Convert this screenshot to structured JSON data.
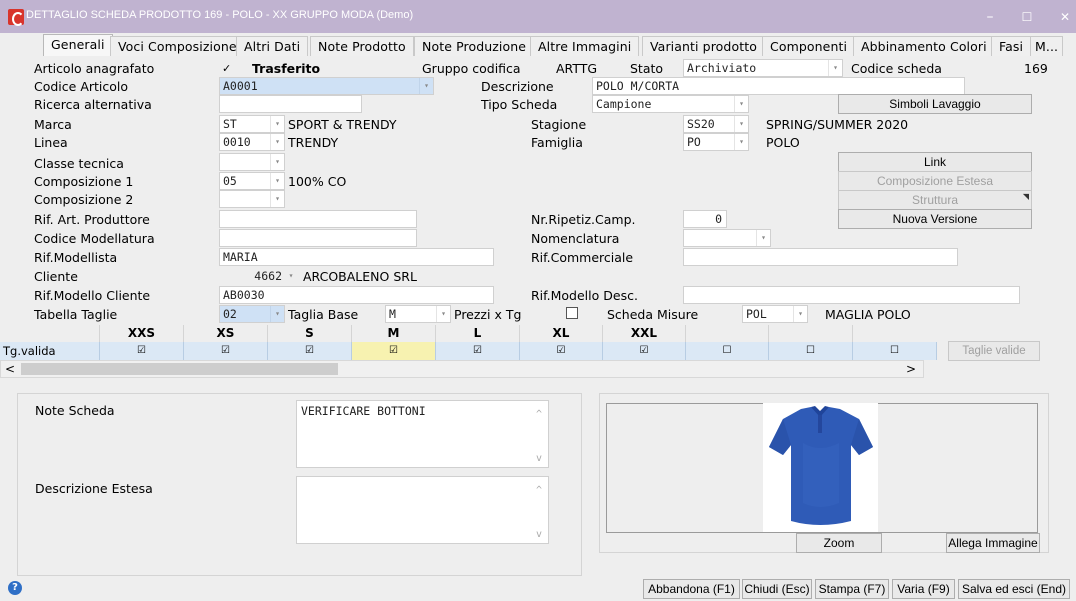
{
  "window": {
    "title": "DETTAGLIO SCHEDA PRODOTTO 169 - POLO - XX  GRUPPO MODA  (Demo)",
    "minimize": "–",
    "maximize": "☐",
    "close": "✕"
  },
  "tabs": [
    {
      "label": "Generali"
    },
    {
      "label": "Voci Composizione"
    },
    {
      "label": "Altri Dati"
    },
    {
      "label": "Note Prodotto"
    },
    {
      "label": "Note Produzione"
    },
    {
      "label": "Altre Immagini"
    },
    {
      "label": "Varianti prodotto"
    },
    {
      "label": "Componenti"
    },
    {
      "label": "Abbinamento Colori"
    },
    {
      "label": "Fasi"
    },
    {
      "label": "M..."
    }
  ],
  "form": {
    "articolo_anagrafato_label": "Articolo anagrafato",
    "articolo_anagrafato_check": "✓",
    "trasferito": "Trasferito",
    "gruppo_codifica_label": "Gruppo codifica",
    "gruppo_codifica_value": "ARTTG",
    "stato_label": "Stato",
    "stato_value": "Archiviato",
    "codice_scheda_label": "Codice scheda",
    "codice_scheda_value": "169",
    "codice_articolo_label": "Codice Articolo",
    "codice_articolo_value": "A0001",
    "descrizione_label": "Descrizione",
    "descrizione_value": "POLO M/CORTA",
    "ricerca_alt_label": "Ricerca alternativa",
    "ricerca_alt_value": "",
    "tipo_scheda_label": "Tipo Scheda",
    "tipo_scheda_value": "Campione",
    "marca_label": "Marca",
    "marca_code": "ST",
    "marca_desc": "SPORT & TRENDY",
    "stagione_label": "Stagione",
    "stagione_code": "SS20",
    "stagione_desc": "SPRING/SUMMER 2020",
    "linea_label": "Linea",
    "linea_code": "0010",
    "linea_desc": "TRENDY",
    "famiglia_label": "Famiglia",
    "famiglia_code": "PO",
    "famiglia_desc": "POLO",
    "classe_tecnica_label": "Classe tecnica",
    "classe_tecnica_value": "",
    "composizione1_label": "Composizione 1",
    "composizione1_code": "05",
    "composizione1_desc": "100% CO",
    "composizione2_label": "Composizione 2",
    "composizione2_code": "",
    "rif_art_prod_label": "Rif. Art. Produttore",
    "rif_art_prod_value": "",
    "nr_ripetiz_label": "Nr.Ripetiz.Camp.",
    "nr_ripetiz_value": "0",
    "codice_modellatura_label": "Codice Modellatura",
    "codice_modellatura_value": "",
    "nomenclatura_label": "Nomenclatura",
    "nomenclatura_value": "",
    "rif_modellista_label": "Rif.Modellista",
    "rif_modellista_value": "MARIA",
    "rif_commerciale_label": "Rif.Commerciale",
    "rif_commerciale_value": "",
    "cliente_label": "Cliente",
    "cliente_code": "4662",
    "cliente_desc": "ARCOBALENO SRL",
    "rif_modello_cliente_label": "Rif.Modello Cliente",
    "rif_modello_cliente_value": "AB0030",
    "rif_modello_desc_label": "Rif.Modello Desc.",
    "rif_modello_desc_value": "",
    "tabella_taglie_label": "Tabella Taglie",
    "tabella_taglie_value": "02",
    "taglia_base_label": "Taglia Base",
    "taglia_base_value": "M",
    "prezzi_x_tg_label": "Prezzi x Tg",
    "scheda_misure_label": "Scheda Misure",
    "scheda_misure_code": "POL",
    "scheda_misure_desc": "MAGLIA POLO"
  },
  "side_buttons": {
    "simboli_lavaggio": "Simboli Lavaggio",
    "link": "Link",
    "composizione_estesa": "Composizione Estesa",
    "struttura": "Struttura",
    "nuova_versione": "Nuova Versione"
  },
  "sizes_grid": {
    "row_label": "Tg.valida",
    "headers": [
      "XXS",
      "XS",
      "S",
      "M",
      "L",
      "XL",
      "XXL",
      "",
      "",
      "",
      ""
    ],
    "cells": [
      "☑",
      "☑",
      "☑",
      "☑",
      "☑",
      "☑",
      "☑",
      "☐",
      "☐",
      "☐",
      "☐"
    ],
    "taglie_valide_button": "Taglie valide",
    "scroll_left": "<",
    "scroll_right": ">"
  },
  "notes": {
    "note_scheda_label": "Note Scheda",
    "note_scheda_value": "VERIFICARE BOTTONI",
    "descrizione_estesa_label": "Descrizione Estesa",
    "descrizione_estesa_value": ""
  },
  "image_panel": {
    "zoom": "Zoom",
    "allega_immagine": "Allega Immagine",
    "shirt_color": "#2f5bb7"
  },
  "footer": {
    "help": "?",
    "abbandona": "Abbandona (F1)",
    "chiudi": "Chiudi (Esc)",
    "stampa": "Stampa (F7)",
    "varia": "Varia (F9)",
    "salva": "Salva ed esci (End)"
  }
}
